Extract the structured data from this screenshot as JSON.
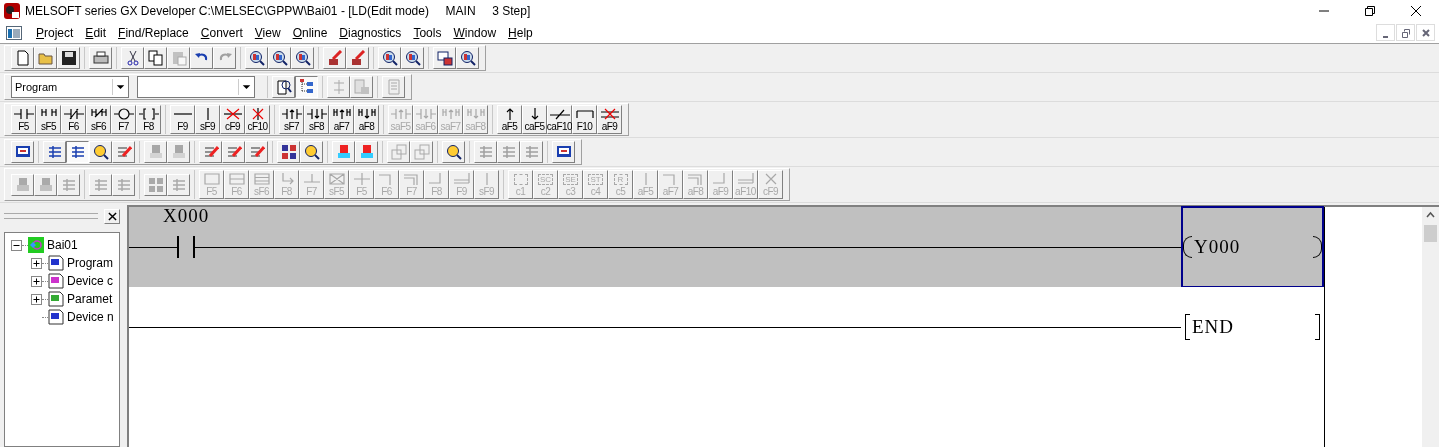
{
  "window": {
    "title": "MELSOFT series GX Developer C:\\MELSEC\\GPPW\\Bai01 - [LD(Edit mode)     MAIN     3 Step]"
  },
  "menu": [
    "Project",
    "Edit",
    "Find/Replace",
    "Convert",
    "View",
    "Online",
    "Diagnostics",
    "Tools",
    "Window",
    "Help"
  ],
  "toolbar_1": [
    [
      {
        "disabled": false
      },
      {
        "disabled": false
      },
      {
        "disabled": false
      }
    ],
    [
      {
        "disabled": false
      }
    ],
    [
      {
        "disabled": false
      },
      {
        "disabled": false
      },
      {
        "disabled": true
      },
      {
        "disabled": false
      },
      {
        "disabled": true
      }
    ],
    [
      {
        "disabled": false
      },
      {
        "disabled": false
      },
      {
        "disabled": false
      }
    ],
    [
      {
        "disabled": false
      },
      {
        "disabled": false
      }
    ],
    [
      {
        "disabled": false
      },
      {
        "disabled": false
      }
    ],
    [
      {
        "disabled": false
      },
      {
        "disabled": false
      }
    ]
  ],
  "toolbar_2": {
    "data_type": "Program",
    "buttons": [
      [
        {
          "disabled": false,
          "pressed": false
        },
        {
          "disabled": false,
          "pressed": true
        }
      ],
      [
        {
          "disabled": true,
          "pressed": false
        },
        {
          "disabled": true,
          "pressed": false
        }
      ],
      [
        {
          "disabled": true,
          "pressed": false
        }
      ]
    ]
  },
  "ladder_keys": [
    [
      {
        "kind": "contact",
        "key": "F5",
        "disabled": false
      },
      {
        "kind": "parallel-contact",
        "key": "sF5",
        "disabled": false
      },
      {
        "kind": "break-contact",
        "key": "F6",
        "disabled": false
      },
      {
        "kind": "parallel-break",
        "key": "sF6",
        "disabled": false
      },
      {
        "kind": "coil",
        "key": "F7",
        "disabled": false
      },
      {
        "kind": "instruction",
        "key": "F8",
        "disabled": false
      }
    ],
    [
      {
        "kind": "hline",
        "key": "F9",
        "disabled": false
      },
      {
        "kind": "vline",
        "key": "sF9",
        "disabled": false
      },
      {
        "kind": "delete-hline",
        "key": "cF9",
        "disabled": false
      },
      {
        "kind": "delete-vline",
        "key": "cF10",
        "disabled": false
      }
    ],
    [
      {
        "kind": "rise",
        "key": "sF7",
        "disabled": false
      },
      {
        "kind": "fall",
        "key": "sF8",
        "disabled": false
      },
      {
        "kind": "parallel-rise",
        "key": "aF7",
        "disabled": false
      },
      {
        "kind": "parallel-fall",
        "key": "aF8",
        "disabled": false
      }
    ],
    [
      {
        "kind": "rise",
        "key": "saF5",
        "disabled": true
      },
      {
        "kind": "fall",
        "key": "saF6",
        "disabled": true
      },
      {
        "kind": "parallel-rise",
        "key": "saF7",
        "disabled": true
      },
      {
        "kind": "parallel-fall",
        "key": "saF8",
        "disabled": true
      }
    ],
    [
      {
        "kind": "up-arrow",
        "key": "aF5",
        "disabled": false
      },
      {
        "kind": "down-arrow",
        "key": "caF5",
        "disabled": false
      },
      {
        "kind": "invert",
        "key": "caF10",
        "disabled": false
      },
      {
        "kind": "line-draw",
        "key": "F10",
        "disabled": false
      },
      {
        "kind": "line-delete",
        "key": "aF9",
        "disabled": false
      }
    ]
  ],
  "toolbar_4": [
    [
      {
        "disabled": false,
        "pressed": false
      }
    ],
    [
      {
        "disabled": false,
        "pressed": false
      },
      {
        "disabled": false,
        "pressed": true
      },
      {
        "disabled": false,
        "pressed": false
      },
      {
        "disabled": false,
        "pressed": false
      }
    ],
    [
      {
        "disabled": true,
        "pressed": false
      },
      {
        "disabled": true,
        "pressed": false
      }
    ],
    [
      {
        "disabled": false,
        "pressed": false
      },
      {
        "disabled": false,
        "pressed": false
      },
      {
        "disabled": false,
        "pressed": false
      }
    ],
    [
      {
        "disabled": false,
        "pressed": false
      },
      {
        "disabled": false,
        "pressed": false
      }
    ],
    [
      {
        "disabled": false,
        "pressed": false
      },
      {
        "disabled": false,
        "pressed": false
      }
    ],
    [
      {
        "disabled": true,
        "pressed": false
      },
      {
        "disabled": true,
        "pressed": false
      }
    ],
    [
      {
        "disabled": false,
        "pressed": false
      }
    ],
    [
      {
        "disabled": true,
        "pressed": false
      },
      {
        "disabled": true,
        "pressed": false
      },
      {
        "disabled": true,
        "pressed": false
      }
    ],
    [
      {
        "disabled": false,
        "pressed": false
      }
    ]
  ],
  "toolbar_5": {
    "icons": [
      [
        {
          "disabled": true
        },
        {
          "disabled": true
        },
        {
          "disabled": true
        }
      ],
      [
        {
          "disabled": true
        },
        {
          "disabled": true
        }
      ],
      [
        {
          "disabled": true
        },
        {
          "disabled": true
        }
      ]
    ],
    "keys": [
      {
        "kind": "box",
        "key": "F5",
        "disabled": true
      },
      {
        "kind": "double-box",
        "key": "F6",
        "disabled": true
      },
      {
        "kind": "triple-box",
        "key": "sF6",
        "disabled": true
      },
      {
        "kind": "corner-arrow",
        "key": "F8",
        "disabled": true
      },
      {
        "kind": "t-line",
        "key": "F7",
        "disabled": true
      },
      {
        "kind": "cross-box",
        "key": "sF5",
        "disabled": true
      },
      {
        "kind": "cross",
        "key": "F5",
        "disabled": true
      },
      {
        "kind": "corner-down",
        "key": "F6",
        "disabled": true
      },
      {
        "kind": "corner-double",
        "key": "F7",
        "disabled": true
      },
      {
        "kind": "corner-up",
        "key": "F8",
        "disabled": true
      },
      {
        "kind": "double-line",
        "key": "F9",
        "disabled": true
      },
      {
        "kind": "vline",
        "key": "sF9",
        "disabled": true
      }
    ],
    "block_keys": [
      {
        "kind": "dashed-box",
        "key": "c1",
        "disabled": true
      },
      {
        "kind": "dashed-box",
        "mark": "SC",
        "key": "c2",
        "disabled": true
      },
      {
        "kind": "dashed-box",
        "mark": "SE",
        "key": "c3",
        "disabled": true
      },
      {
        "kind": "dashed-box",
        "mark": "ST",
        "key": "c4",
        "disabled": true
      },
      {
        "kind": "dashed-box",
        "mark": "R",
        "key": "c5",
        "disabled": true
      },
      {
        "kind": "vline",
        "key": "aF5",
        "disabled": true
      },
      {
        "kind": "corner-down",
        "key": "aF7",
        "disabled": true
      },
      {
        "kind": "corner-double",
        "key": "aF8",
        "disabled": true
      },
      {
        "kind": "corner-up",
        "key": "aF9",
        "disabled": true
      },
      {
        "kind": "double-line",
        "key": "aF10",
        "disabled": true
      },
      {
        "kind": "x-mark",
        "key": "cF9",
        "disabled": true
      }
    ]
  },
  "project_tree": {
    "label": "Bai01",
    "expanded": true,
    "children": [
      {
        "label": "Program",
        "has_children": true,
        "expanded": false
      },
      {
        "label": "Device c",
        "has_children": true,
        "expanded": false
      },
      {
        "label": "Paramet",
        "has_children": true,
        "expanded": false
      },
      {
        "label": "Device n",
        "has_children": false
      }
    ]
  },
  "ladder": {
    "rungs": [
      {
        "kind": "contact-coil",
        "selected": true,
        "contact": "X000",
        "coil": "Y000",
        "cursor": true
      },
      {
        "kind": "end",
        "selected": false,
        "instruction": "END",
        "cursor": false
      }
    ]
  }
}
